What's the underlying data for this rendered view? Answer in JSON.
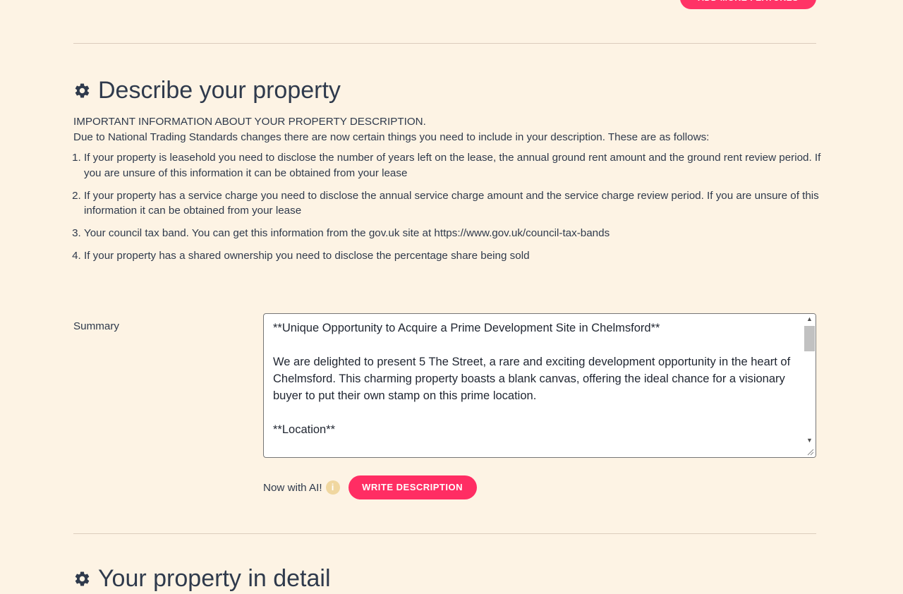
{
  "top_button": {
    "label": "ADD MORE FEATURES"
  },
  "describe_section": {
    "title": "Describe your property",
    "icon": "gear-icon",
    "info_heading": "IMPORTANT INFORMATION ABOUT YOUR PROPERTY DESCRIPTION.",
    "info_intro": "Due to National Trading Standards changes there are now certain things you need to include in your description. These are as follows:",
    "requirements": [
      "If your property is leasehold you need to disclose the number of years left on the lease, the annual ground rent amount and the ground rent review period. If you are unsure of this information it can be obtained from your lease",
      "If your property has a service charge you need to disclose the annual service charge amount and the service charge review period. If you are unsure of this information it can be obtained from your lease",
      "Your council tax band. You can get this information from the gov.uk site at https://www.gov.uk/council-tax-bands",
      "If your property has a shared ownership you need to disclose the percentage share being sold"
    ]
  },
  "summary": {
    "label": "Summary",
    "value": "**Unique Opportunity to Acquire a Prime Development Site in Chelmsford**\n\nWe are delighted to present 5 The Street, a rare and exciting development opportunity in the heart of Chelmsford. This charming property boasts a blank canvas, offering the ideal chance for a visionary buyer to put their own stamp on this prime location.\n\n**Location**"
  },
  "ai": {
    "label": "Now with AI!",
    "info_icon_glyph": "i",
    "button_label": "WRITE DESCRIPTION"
  },
  "detail_section": {
    "title": "Your property in detail",
    "icon": "gear-icon"
  },
  "colors": {
    "background": "#fdf3e4",
    "accent": "#ff2d63",
    "text": "#2f3a4c",
    "divider": "#dcccbc"
  }
}
